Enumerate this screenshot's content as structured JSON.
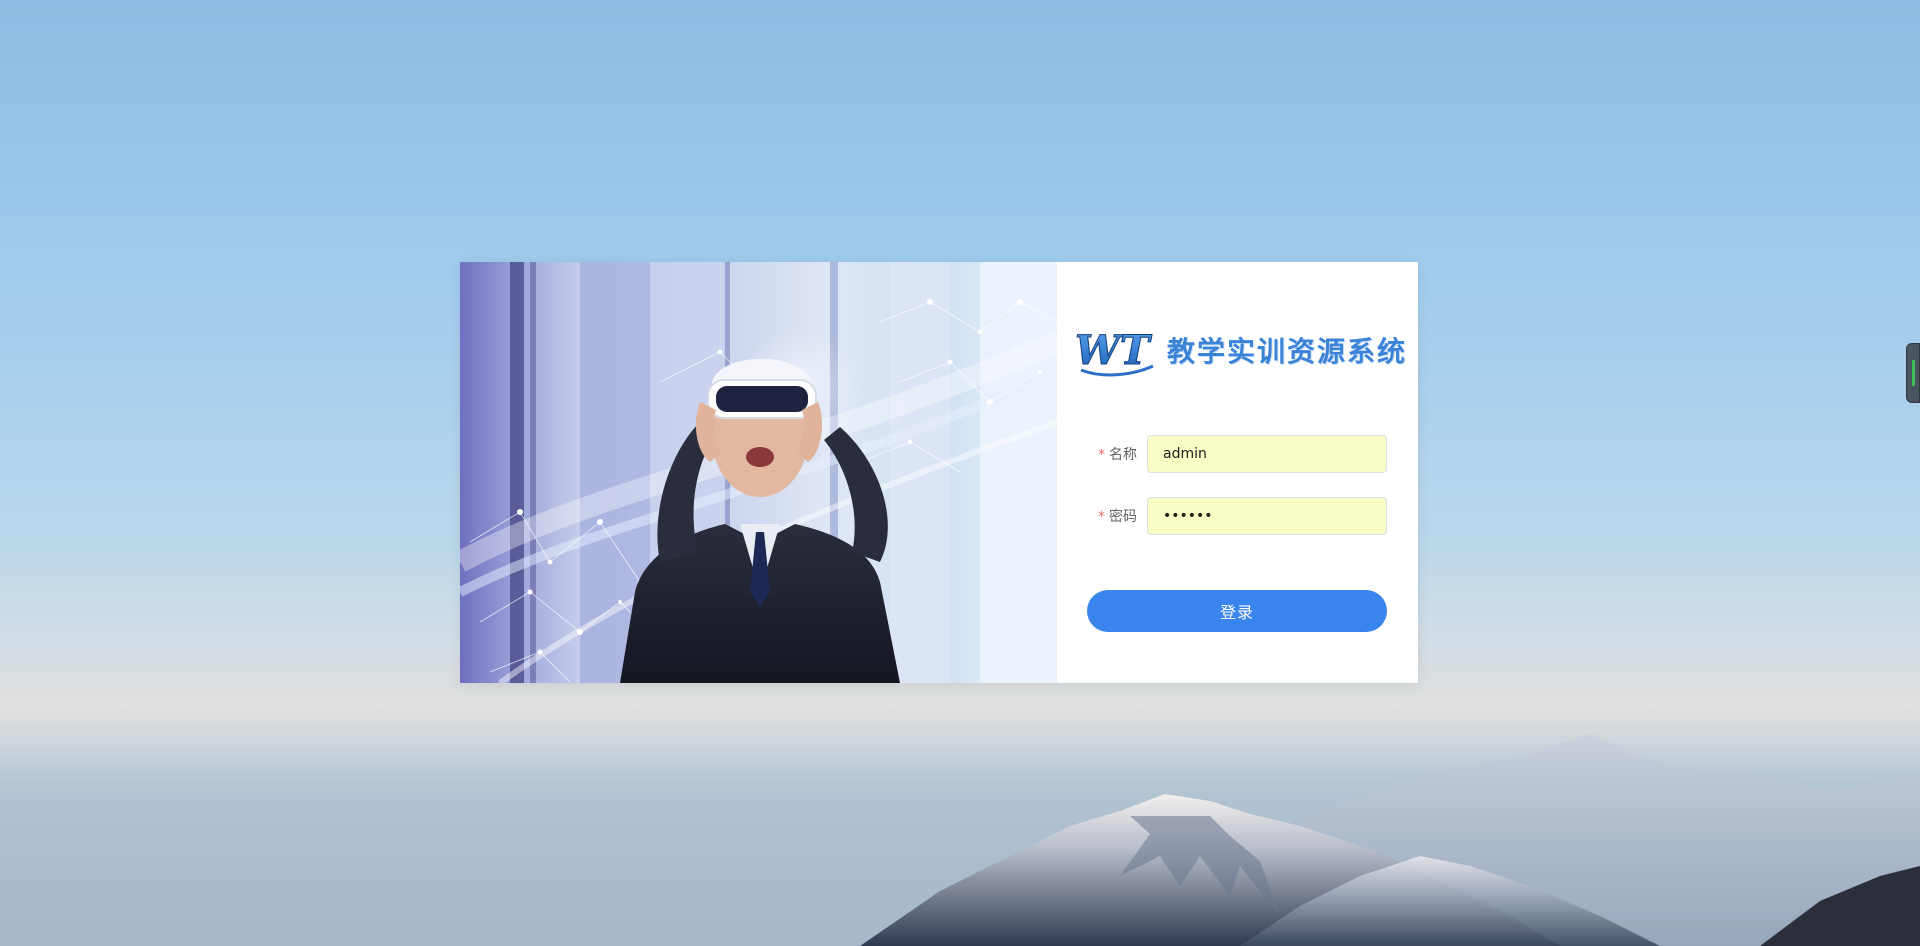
{
  "brand": {
    "logo_text": "WT",
    "title": "教学实训资源系统"
  },
  "form": {
    "name_label": "名称",
    "name_required_mark": "*",
    "name_value": "admin",
    "password_label": "密码",
    "password_required_mark": "*",
    "password_value": "123456",
    "login_button": "登录"
  },
  "colors": {
    "accent": "#3a84ee",
    "brand_title": "#3b83d8",
    "required": "#f56c6c",
    "autofill_bg": "#fafcc6"
  },
  "icons": {
    "side_tab": "extension-handle-icon"
  }
}
